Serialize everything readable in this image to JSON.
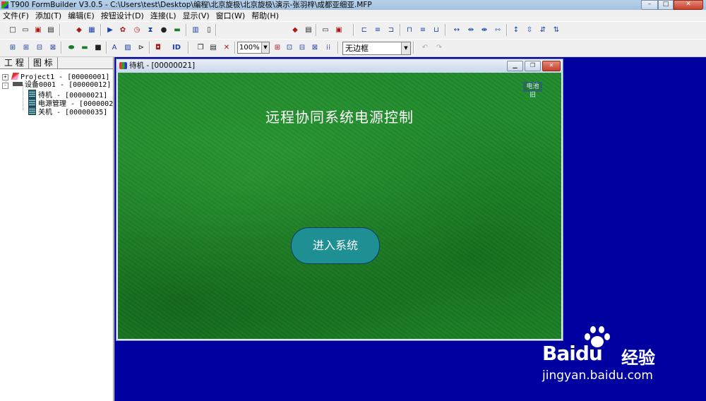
{
  "window": {
    "title": "T900 FormBuilder V3.0.5 - C:\\Users\\test\\Desktop\\编程\\北京旋极\\北京旋极\\演示-张羽梓\\成都亚细亚.MFP",
    "min": "–",
    "max": "□",
    "close": "✕"
  },
  "menu": [
    "文件(F)",
    "添加(T)",
    "编辑(E)",
    "按钮设计(D)",
    "连接(L)",
    "显示(V)",
    "窗口(W)",
    "帮助(H)"
  ],
  "toolbar": {
    "zoom": "100%",
    "border_style": "无边框"
  },
  "left_panel": {
    "tabs": [
      "工 程",
      "图 标"
    ],
    "tree": [
      {
        "label": "Project1 - [00000001]",
        "expander": "+"
      },
      {
        "label": "设备0001 - [00000012]",
        "expander": "-"
      },
      {
        "label": "待机 - [00000021]"
      },
      {
        "label": "电源管理 - [0000002"
      },
      {
        "label": "关机 - [00000035]"
      }
    ]
  },
  "child_window": {
    "title": "待机 - [00000021]",
    "canvas": {
      "heading": "远程协同系统电源控制",
      "battery_label": "电池旧",
      "enter_button": "进入系统"
    }
  },
  "watermark": {
    "brand_left": "Bai",
    "brand_right": "经验",
    "url": "jingyan.baidu.com"
  },
  "colors": {
    "mdi_background": "#0000a0",
    "canvas_green": "#1f8a2b",
    "enter_button": "#1e8f93"
  }
}
